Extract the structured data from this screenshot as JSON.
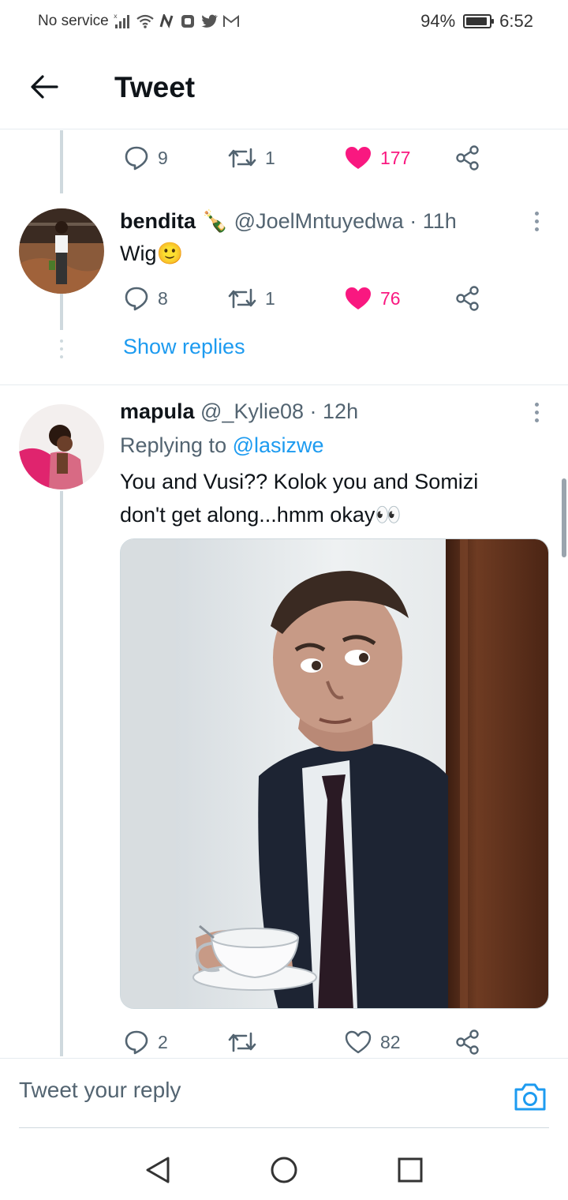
{
  "status_bar": {
    "carrier": "No service",
    "battery": "94%",
    "time": "6:52"
  },
  "header": {
    "title": "Tweet",
    "back_icon": "arrow-left-icon"
  },
  "top_actions": {
    "replies": "9",
    "retweets": "1",
    "likes": "177"
  },
  "tweet1": {
    "name": "bendita",
    "name_emoji": "🍾",
    "handle": "@JoelMntuyedwa",
    "time": "· 11h",
    "text": "Wig",
    "text_emoji": "🙂",
    "replies": "8",
    "retweets": "1",
    "likes": "76",
    "show_replies": "Show replies"
  },
  "tweet2": {
    "name": "mapula",
    "handle": "@_Kylie08",
    "time": "· 12h",
    "replying_prefix": "Replying to",
    "replying_to": "@lasizwe",
    "text_line1": "You and Vusi?? Kolok you and Somizi",
    "text_line2": "don't get along...hmm okay",
    "text_emoji": "👀",
    "replies": "2",
    "retweets": "",
    "likes": "82"
  },
  "reply_bar": {
    "placeholder": "Tweet your reply",
    "camera_icon": "camera-icon"
  },
  "colors": {
    "accent": "#1d9bf0",
    "like": "#f91880",
    "muted": "#536471"
  }
}
